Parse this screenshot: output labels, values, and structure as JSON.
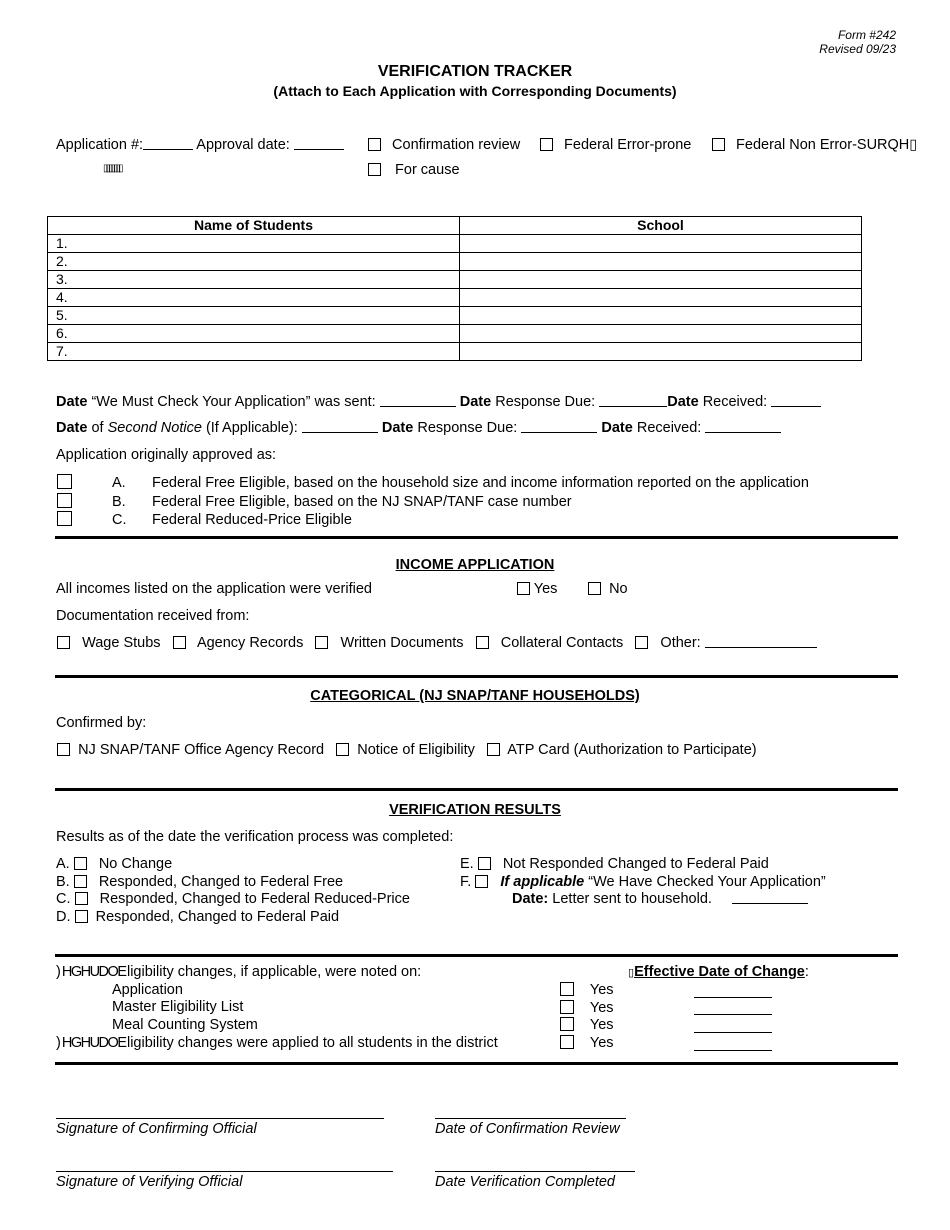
{
  "header": {
    "form_number": "Form #242",
    "revised": "Revised 09/23",
    "title": "VERIFICATION TRACKER",
    "subtitle": "(Attach to Each Application with Corresponding Documents)"
  },
  "app_info": {
    "application_label": "Application #:",
    "approval_label": "Approval date:",
    "garbled_glyphs": "▯▯▯▯▯▯▯",
    "review_types": [
      {
        "label": "Confirmation review",
        "checked": false
      },
      {
        "label": "Federal Error-prone",
        "checked": false
      },
      {
        "label": "Federal Non Error-SURQH▯",
        "checked": false
      },
      {
        "label": "For cause",
        "checked": false
      }
    ]
  },
  "students_table": {
    "headers": [
      "Name of Students",
      "School"
    ],
    "rows": [
      {
        "num": "1.",
        "name": "",
        "school": ""
      },
      {
        "num": "2.",
        "name": "",
        "school": ""
      },
      {
        "num": "3.",
        "name": "",
        "school": ""
      },
      {
        "num": "4.",
        "name": "",
        "school": ""
      },
      {
        "num": "5.",
        "name": "",
        "school": ""
      },
      {
        "num": "6.",
        "name": "",
        "school": ""
      },
      {
        "num": "7.",
        "name": "",
        "school": ""
      }
    ]
  },
  "dates": {
    "date_word": "Date",
    "line1_sent": "“We Must Check Your Application” was sent:",
    "line1_due": "Response Due:",
    "line1_received": "Received:",
    "line2_of": "of",
    "line2_second_notice": "Second Notice",
    "line2_if_applicable": "(If Applicable):",
    "line2_due": "Response Due:",
    "line2_received": "Received:"
  },
  "original_approval": {
    "label": "Application originally approved as:",
    "options": [
      {
        "letter": "A.",
        "text": "Federal Free Eligible, based on the household size and income information reported on the application",
        "checked": false
      },
      {
        "letter": "B.",
        "text": "Federal Free Eligible, based on the NJ SNAP/TANF case number",
        "checked": false
      },
      {
        "letter": "C.",
        "text": "Federal Reduced-Price Eligible",
        "checked": false
      }
    ]
  },
  "income": {
    "heading": "INCOME APPLICATION",
    "verified_question": "All incomes listed on the application were verified",
    "yes": "Yes",
    "no": "No",
    "doc_label": "Documentation received from:",
    "sources": [
      "Wage Stubs",
      "Agency Records",
      "Written Documents",
      "Collateral Contacts",
      "Other:"
    ]
  },
  "categorical": {
    "heading": "CATEGORICAL (NJ SNAP/TANF HOUSEHOLDS)",
    "confirmed_by": "Confirmed by:",
    "options": [
      "NJ SNAP/TANF Office Agency Record",
      "Notice of Eligibility",
      "ATP Card (Authorization to Participate)"
    ]
  },
  "results": {
    "heading": "VERIFICATION RESULTS",
    "intro": "Results as of the date the verification process was completed:",
    "left": [
      {
        "letter": "A.",
        "text": "No Change"
      },
      {
        "letter": "B.",
        "text": "Responded, Changed to Federal Free"
      },
      {
        "letter": "C.",
        "text": "Responded, Changed to Federal Reduced-Price"
      },
      {
        "letter": "D.",
        "text": "Responded, Changed to Federal Paid"
      }
    ],
    "right": [
      {
        "letter": "E.",
        "text": "Not Responded Changed to Federal Paid"
      },
      {
        "letter": "F.",
        "text_bold_italic": "If applicable",
        "text": "“We Have Checked Your Application”"
      }
    ],
    "date_bold": "Date:",
    "date_text": "Letter sent to household."
  },
  "changes": {
    "line1_prefix": ") HGHUDO",
    "line1_text": "Eligibility changes, if applicable, were noted on:",
    "items": [
      "Application",
      "Master Eligibility List",
      "Meal Counting System"
    ],
    "line2_prefix": ") HGHUDO",
    "line2_text": "Eligibility changes were applied to all students in the district",
    "effective_prefix": "▯",
    "effective_heading": "Effective Date of Change",
    "effective_colon": ":",
    "yes": "Yes"
  },
  "signatures": {
    "confirming": "Signature of Confirming Official",
    "confirmation_date": "Date of Confirmation Review",
    "verifying": "Signature of Verifying Official",
    "verification_date": "Date Verification Completed"
  }
}
